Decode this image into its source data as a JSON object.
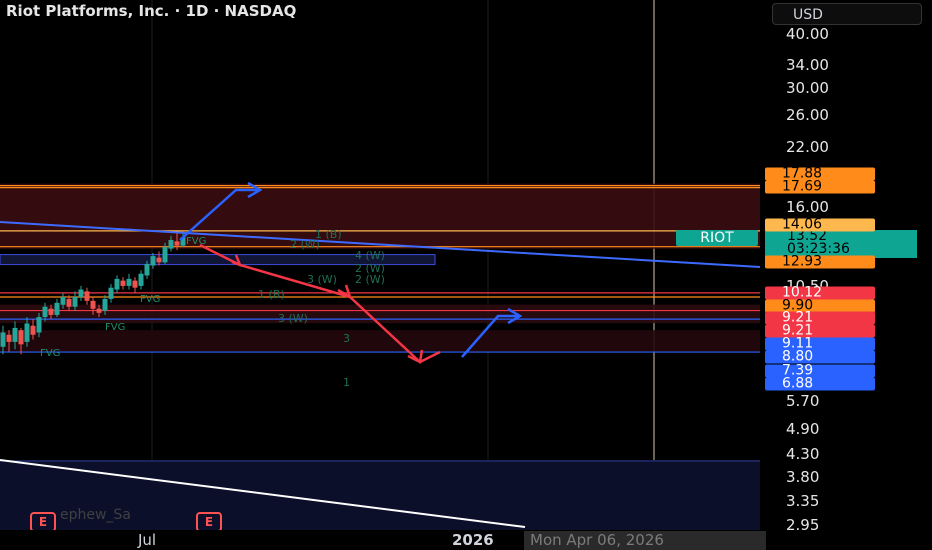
{
  "header": {
    "title": "Riot Platforms, Inc. · 1D · NASDAQ",
    "currency": "USD"
  },
  "chart_data": {
    "type": "line",
    "symbol": "RIOT",
    "y_scale": "log",
    "ylim": [
      2.8,
      44
    ],
    "y_ticks": [
      "40.00",
      "34.00",
      "30.00",
      "26.00",
      "22.00",
      "16.00",
      "10.50",
      "5.70",
      "4.90",
      "4.30",
      "3.80",
      "3.35",
      "2.95"
    ],
    "x_ticks": [
      "Jul",
      "2026"
    ],
    "crosshair_date": "Mon Apr 06, 2026",
    "price_badges": [
      {
        "value": "17.88",
        "color": "#ff8c1a"
      },
      {
        "value": "17.69",
        "color": "#ff8c1a"
      },
      {
        "value": "14.06",
        "color": "#ffb84d"
      },
      {
        "value": "12.93",
        "color": "#ff8c1a"
      },
      {
        "value": "10.12",
        "color": "#f23645"
      },
      {
        "value": "9.90",
        "color": "#ff8c1a"
      },
      {
        "value": "9.21",
        "color": "#f23645"
      },
      {
        "value": "9.21",
        "color": "#f23645"
      },
      {
        "value": "9.11",
        "color": "#2962ff"
      },
      {
        "value": "8.80",
        "color": "#2962ff"
      },
      {
        "value": "7.39",
        "color": "#2962ff"
      },
      {
        "value": "6.88",
        "color": "#2962ff"
      }
    ],
    "last_price": {
      "label": "RIOT",
      "value": "13.52",
      "countdown": "03:23:36",
      "color": "#0fa593"
    },
    "horizontal_levels": [
      {
        "price": 17.88,
        "color": "#ff8c1a"
      },
      {
        "price": 17.69,
        "color": "#ff8c1a"
      },
      {
        "price": 14.06,
        "color": "#ffb84d"
      },
      {
        "price": 12.93,
        "color": "#ff8c1a"
      },
      {
        "price": 10.12,
        "color": "#f23645"
      },
      {
        "price": 9.9,
        "color": "#ff8c1a"
      },
      {
        "price": 9.21,
        "color": "#f23645"
      },
      {
        "price": 8.8,
        "color": "#2962ff"
      },
      {
        "price": 7.39,
        "color": "#2962ff"
      }
    ],
    "wave_labels": [
      "1 (B)",
      "2 (W)",
      "4 (W)",
      "2 (W)",
      "3 (W)",
      "2 (W)",
      "1 (B)",
      "3 (W)",
      "3",
      "1"
    ],
    "fvg_label": "FVG",
    "events": [
      "E",
      "E"
    ],
    "watermark": "ephew_Sa"
  }
}
